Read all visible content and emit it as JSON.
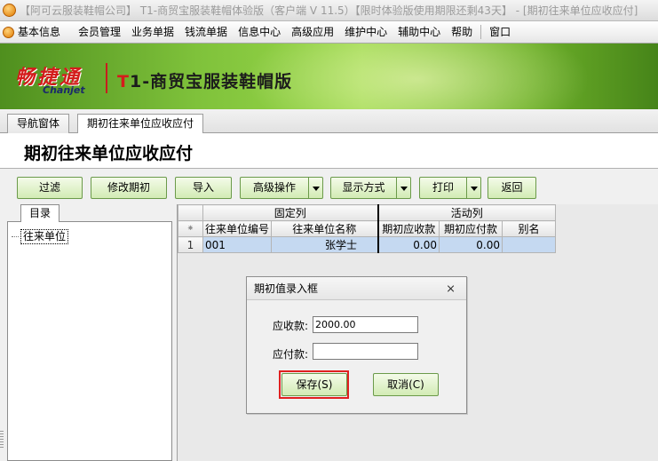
{
  "window": {
    "title": "【阿可云服装鞋帽公司】 T1-商贸宝服装鞋帽体验版（客户端 V 11.5）【限时体验版使用期限还剩43天】 - [期初往来单位应收应付]"
  },
  "menu": {
    "items": [
      "基本信息",
      "会员管理",
      "业务单据",
      "钱流单据",
      "信息中心",
      "高级应用",
      "维护中心",
      "辅助中心",
      "帮助",
      "窗口"
    ]
  },
  "banner": {
    "brand_cn": "畅捷通",
    "brand_en": "Chanjet",
    "product_t": "T",
    "product_rest": "1-商贸宝服装鞋帽版"
  },
  "tabs": [
    "导航窗体",
    "期初往来单位应收应付"
  ],
  "page": {
    "title": "期初往来单位应收应付"
  },
  "toolbar": {
    "filter": "过滤",
    "edit_period": "修改期初",
    "import": "导入",
    "advanced": "高级操作",
    "display_mode": "显示方式",
    "print": "打印",
    "back": "返回"
  },
  "tree": {
    "tab_label": "目录",
    "root": "往来单位"
  },
  "grid": {
    "group_fixed": "固定列",
    "group_active": "活动列",
    "star": "⁕",
    "columns": [
      "往来单位编号",
      "往来单位名称",
      "期初应收款",
      "期初应付款",
      "别名"
    ],
    "rows": [
      {
        "num": "1",
        "code": "001",
        "name": "张学士",
        "receivable": "0.00",
        "payable": "0.00",
        "alias": ""
      }
    ]
  },
  "dialog": {
    "title": "期初值录入框",
    "close_icon": "close-icon",
    "receivable_label": "应收款:",
    "receivable_value": "2000.00",
    "payable_label": "应付款:",
    "payable_value": "",
    "save_button": "保存(S)",
    "cancel_button": "取消(C)"
  },
  "colors": {
    "accent_green": "#d2ebb4",
    "selected_row": "#c5d9f1",
    "highlight": "#e02020"
  }
}
